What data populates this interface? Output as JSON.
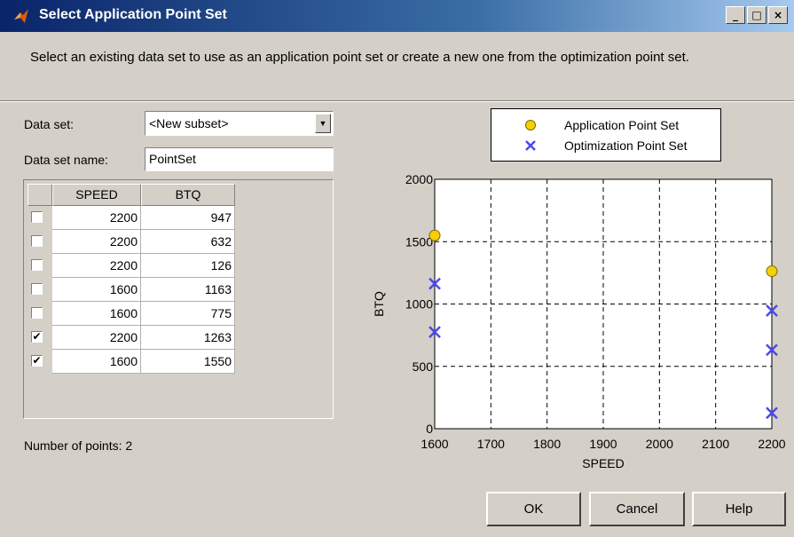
{
  "window": {
    "title": "Select Application Point Set",
    "minimize_glyph": "_",
    "maximize_glyph": "□",
    "close_glyph": "×"
  },
  "instructions": "Select an existing data set to use as an application point set or create a new one from the optimization point set.",
  "form": {
    "dataset_label": "Data set:",
    "dataset_value": "<New subset>",
    "name_label": "Data set name:",
    "name_value": "PointSet"
  },
  "table": {
    "columns": [
      "SPEED",
      "BTQ"
    ],
    "rows": [
      {
        "checked": false,
        "speed": "2200",
        "btq": "947"
      },
      {
        "checked": false,
        "speed": "2200",
        "btq": "632"
      },
      {
        "checked": false,
        "speed": "2200",
        "btq": "126"
      },
      {
        "checked": false,
        "speed": "1600",
        "btq": "1163"
      },
      {
        "checked": false,
        "speed": "1600",
        "btq": "775"
      },
      {
        "checked": true,
        "speed": "2200",
        "btq": "1263"
      },
      {
        "checked": true,
        "speed": "1600",
        "btq": "1550"
      }
    ]
  },
  "points_count_text": "Number of points: 2",
  "buttons": {
    "ok": "OK",
    "cancel": "Cancel",
    "help": "Help"
  },
  "chart_data": {
    "type": "scatter",
    "xlabel": "SPEED",
    "ylabel": "BTQ",
    "xlim": [
      1600,
      2200
    ],
    "ylim": [
      0,
      2000
    ],
    "xticks": [
      1600,
      1700,
      1800,
      1900,
      2000,
      2100,
      2200
    ],
    "yticks": [
      0,
      500,
      1000,
      1500,
      2000
    ],
    "grid": true,
    "legend_position": "top",
    "series": [
      {
        "name": "Application Point Set",
        "marker": "circle",
        "color": "#f5d000",
        "points": [
          [
            1600,
            1550
          ],
          [
            2200,
            1263
          ]
        ]
      },
      {
        "name": "Optimization Point Set",
        "marker": "x",
        "color": "#4a4ae6",
        "points": [
          [
            2200,
            947
          ],
          [
            2200,
            632
          ],
          [
            2200,
            126
          ],
          [
            1600,
            1163
          ],
          [
            1600,
            775
          ]
        ]
      }
    ]
  }
}
